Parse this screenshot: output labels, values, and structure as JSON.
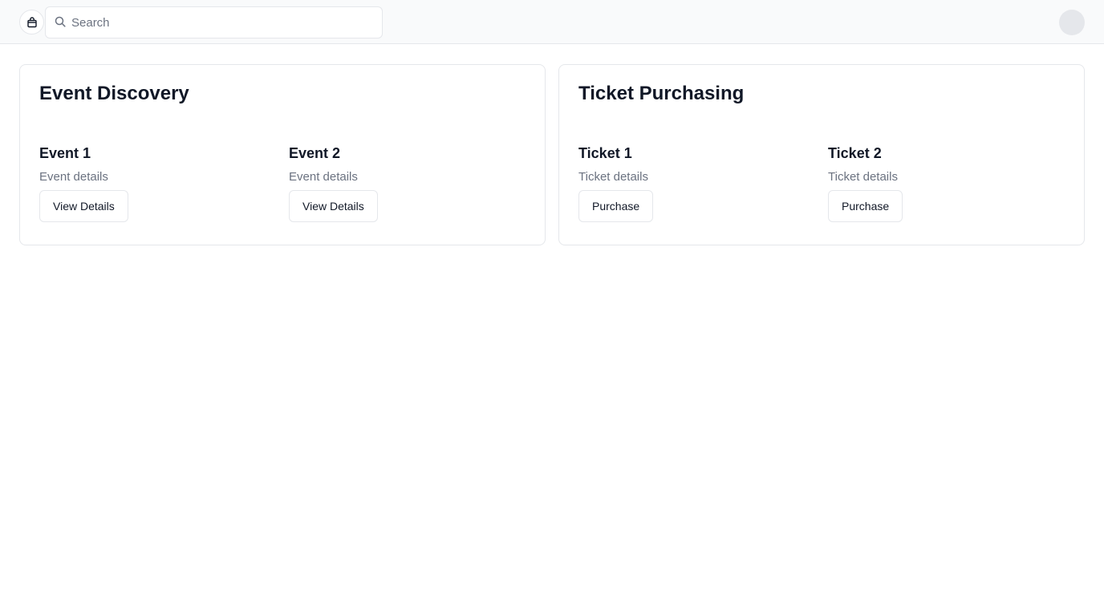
{
  "header": {
    "logo_icon": "shopping-bag-icon",
    "search": {
      "placeholder": "Search",
      "value": "",
      "icon": "search-icon"
    },
    "avatar_color": "#e5e7eb"
  },
  "sections": [
    {
      "title": "Event Discovery",
      "items": [
        {
          "title": "Event 1",
          "details": "Event details",
          "button_label": "View Details"
        },
        {
          "title": "Event 2",
          "details": "Event details",
          "button_label": "View Details"
        }
      ]
    },
    {
      "title": "Ticket Purchasing",
      "items": [
        {
          "title": "Ticket 1",
          "details": "Ticket details",
          "button_label": "Purchase"
        },
        {
          "title": "Ticket 2",
          "details": "Ticket details",
          "button_label": "Purchase"
        }
      ]
    }
  ]
}
